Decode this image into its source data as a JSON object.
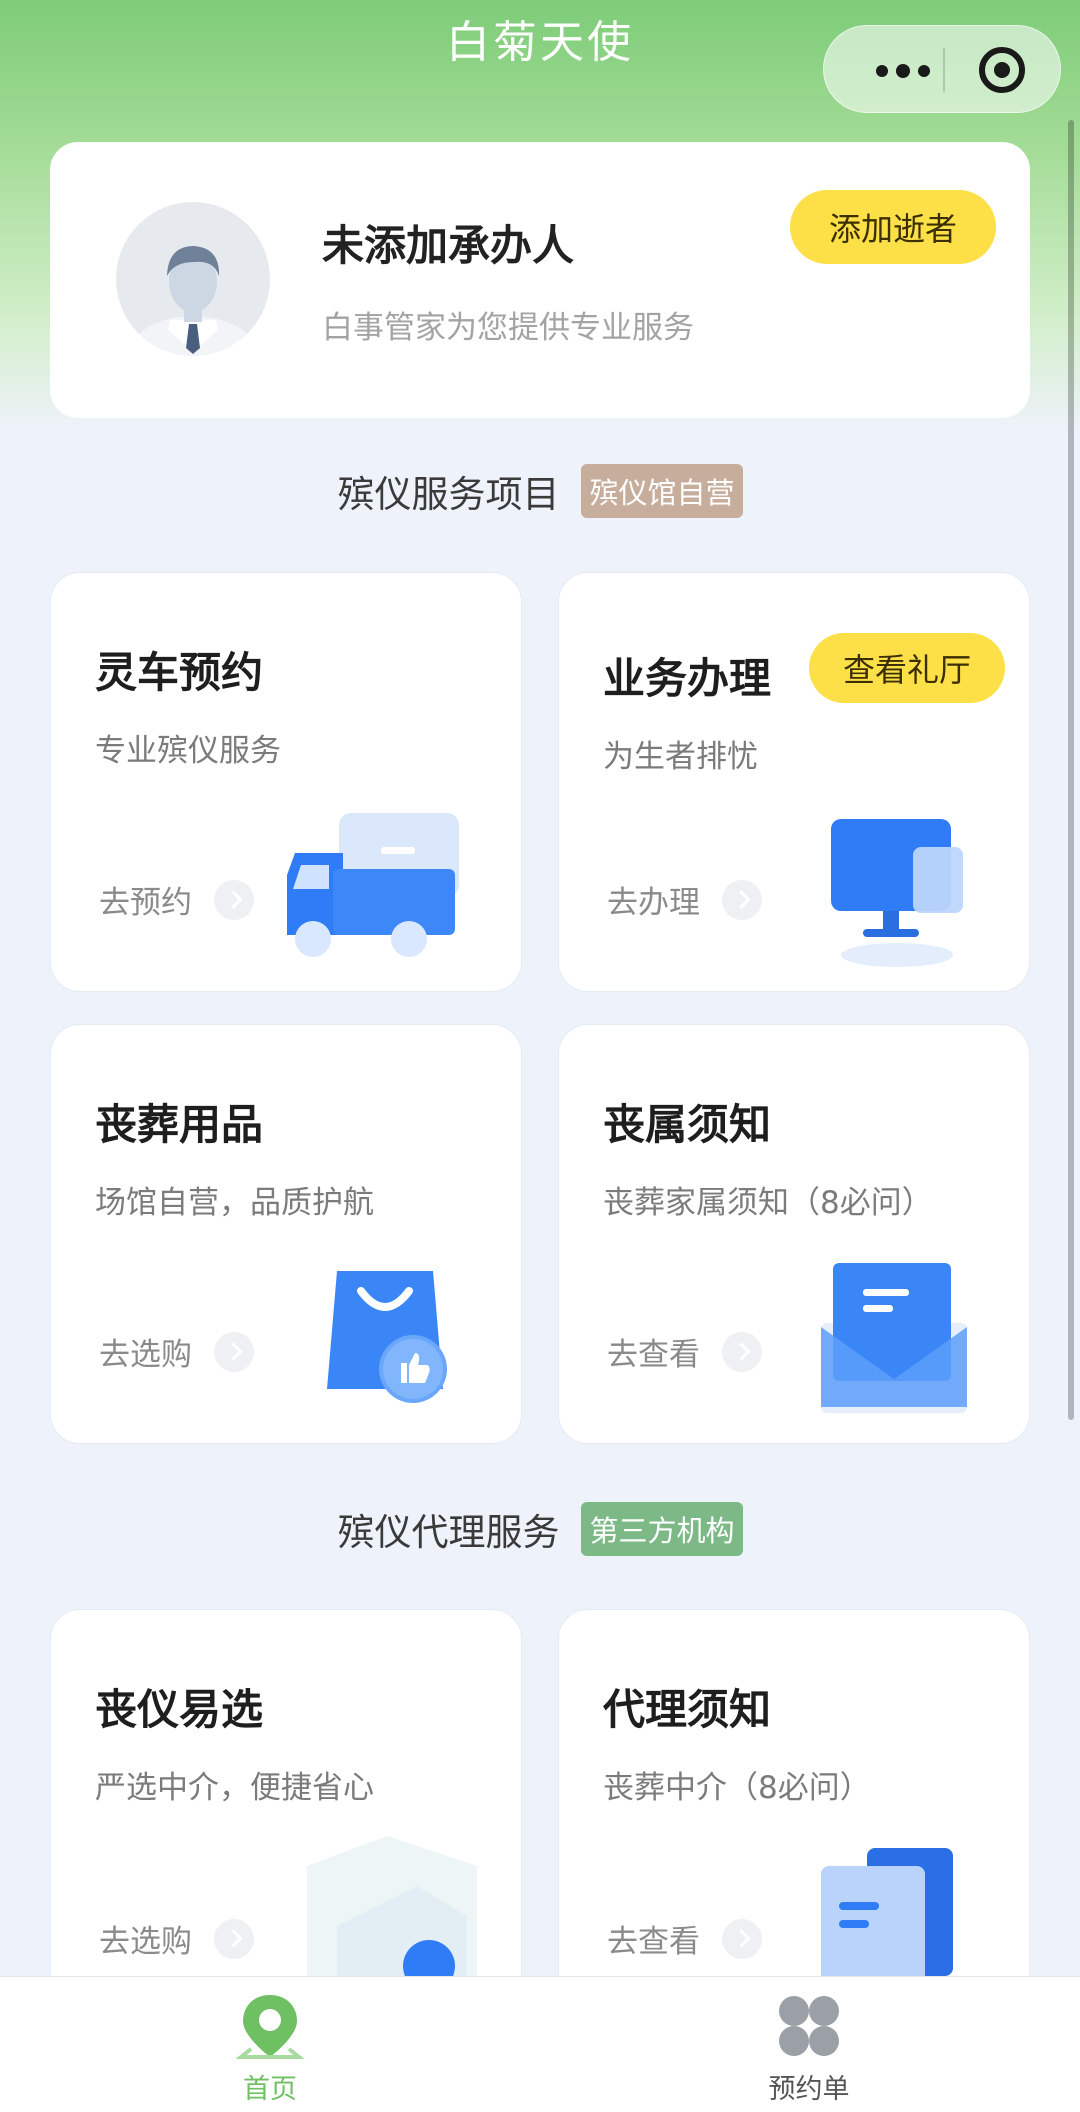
{
  "header": {
    "title": "白菊天使",
    "more_icon": "more-dots-icon",
    "close_icon": "target-icon"
  },
  "profile": {
    "name": "未添加承办人",
    "subtitle": "白事管家为您提供专业服务",
    "add_button": "添加逝者",
    "avatar_icon": "user-avatar-icon"
  },
  "section1": {
    "title": "殡仪服务项目",
    "tag": "殡仪馆自营",
    "tag_color": "#c7ad9c"
  },
  "section2": {
    "title": "殡仪代理服务",
    "tag": "第三方机构",
    "tag_color": "#7cb986"
  },
  "cards": [
    {
      "title": "灵车预约",
      "subtitle": "专业殡仪服务",
      "link": "去预约",
      "icon": "truck-icon"
    },
    {
      "title": "业务办理",
      "subtitle": "为生者排忧",
      "link": "去办理",
      "icon": "computer-icon",
      "badge": "查看礼厅"
    },
    {
      "title": "丧葬用品",
      "subtitle": "场馆自营，品质护航",
      "link": "去选购",
      "icon": "shopping-bag-icon"
    },
    {
      "title": "丧属须知",
      "subtitle": "丧葬家属须知（8必问）",
      "link": "去查看",
      "icon": "envelope-icon"
    },
    {
      "title": "丧仪易选",
      "subtitle": "严选中介，便捷省心",
      "link": "去选购",
      "icon": "package-icon"
    },
    {
      "title": "代理须知",
      "subtitle": "丧葬中介（8必问）",
      "link": "去查看",
      "icon": "document-icon"
    }
  ],
  "bottom_nav": [
    {
      "label": "首页",
      "icon": "home-location-icon",
      "active": true
    },
    {
      "label": "预约单",
      "icon": "grid-icon",
      "active": false
    }
  ],
  "colors": {
    "accent_yellow": "#fde047",
    "active_green": "#6fbf63",
    "primary_blue": "#2f7cf6"
  }
}
